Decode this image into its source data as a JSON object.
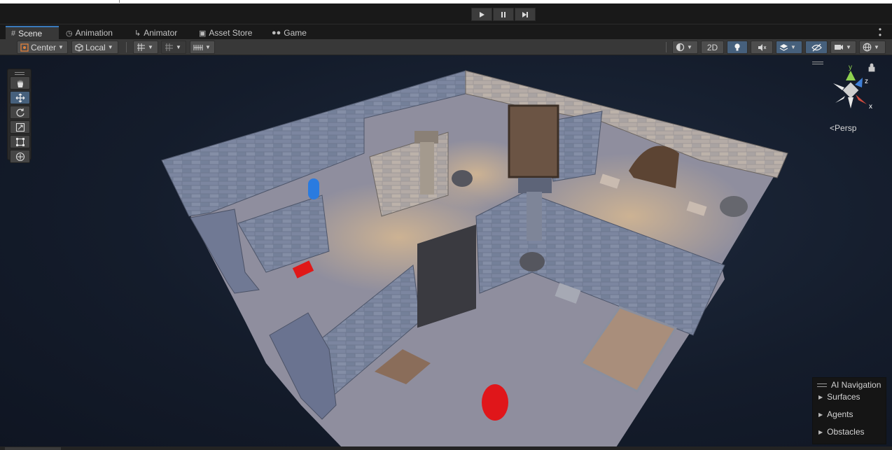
{
  "playbar": {
    "play_icon": "play-icon",
    "pause_icon": "pause-icon",
    "step_icon": "step-icon"
  },
  "tabs": [
    {
      "label": "Scene",
      "icon": "grid-icon",
      "active": true
    },
    {
      "label": "Animation",
      "icon": "clock-icon",
      "active": false
    },
    {
      "label": "Animator",
      "icon": "graph-icon",
      "active": false
    },
    {
      "label": "Asset Store",
      "icon": "bag-icon",
      "active": false
    },
    {
      "label": "Game",
      "icon": "gamepad-icon",
      "active": false
    }
  ],
  "toolbar": {
    "pivot_label": "Center",
    "rotation_label": "Local",
    "mode_2d_label": "2D"
  },
  "tools": [
    "hand-tool",
    "move-tool",
    "rotate-tool",
    "scale-tool",
    "rect-tool",
    "transform-tool"
  ],
  "gizmo": {
    "y_label": "y",
    "z_label": "z",
    "x_label": "x",
    "projection_label": "Persp",
    "colors": {
      "x": "#d24b3e",
      "y": "#8fd14f",
      "z": "#3f7fd6"
    }
  },
  "ai_navigation": {
    "title": "AI Navigation",
    "items": [
      "Surfaces",
      "Agents",
      "Obstacles"
    ]
  }
}
